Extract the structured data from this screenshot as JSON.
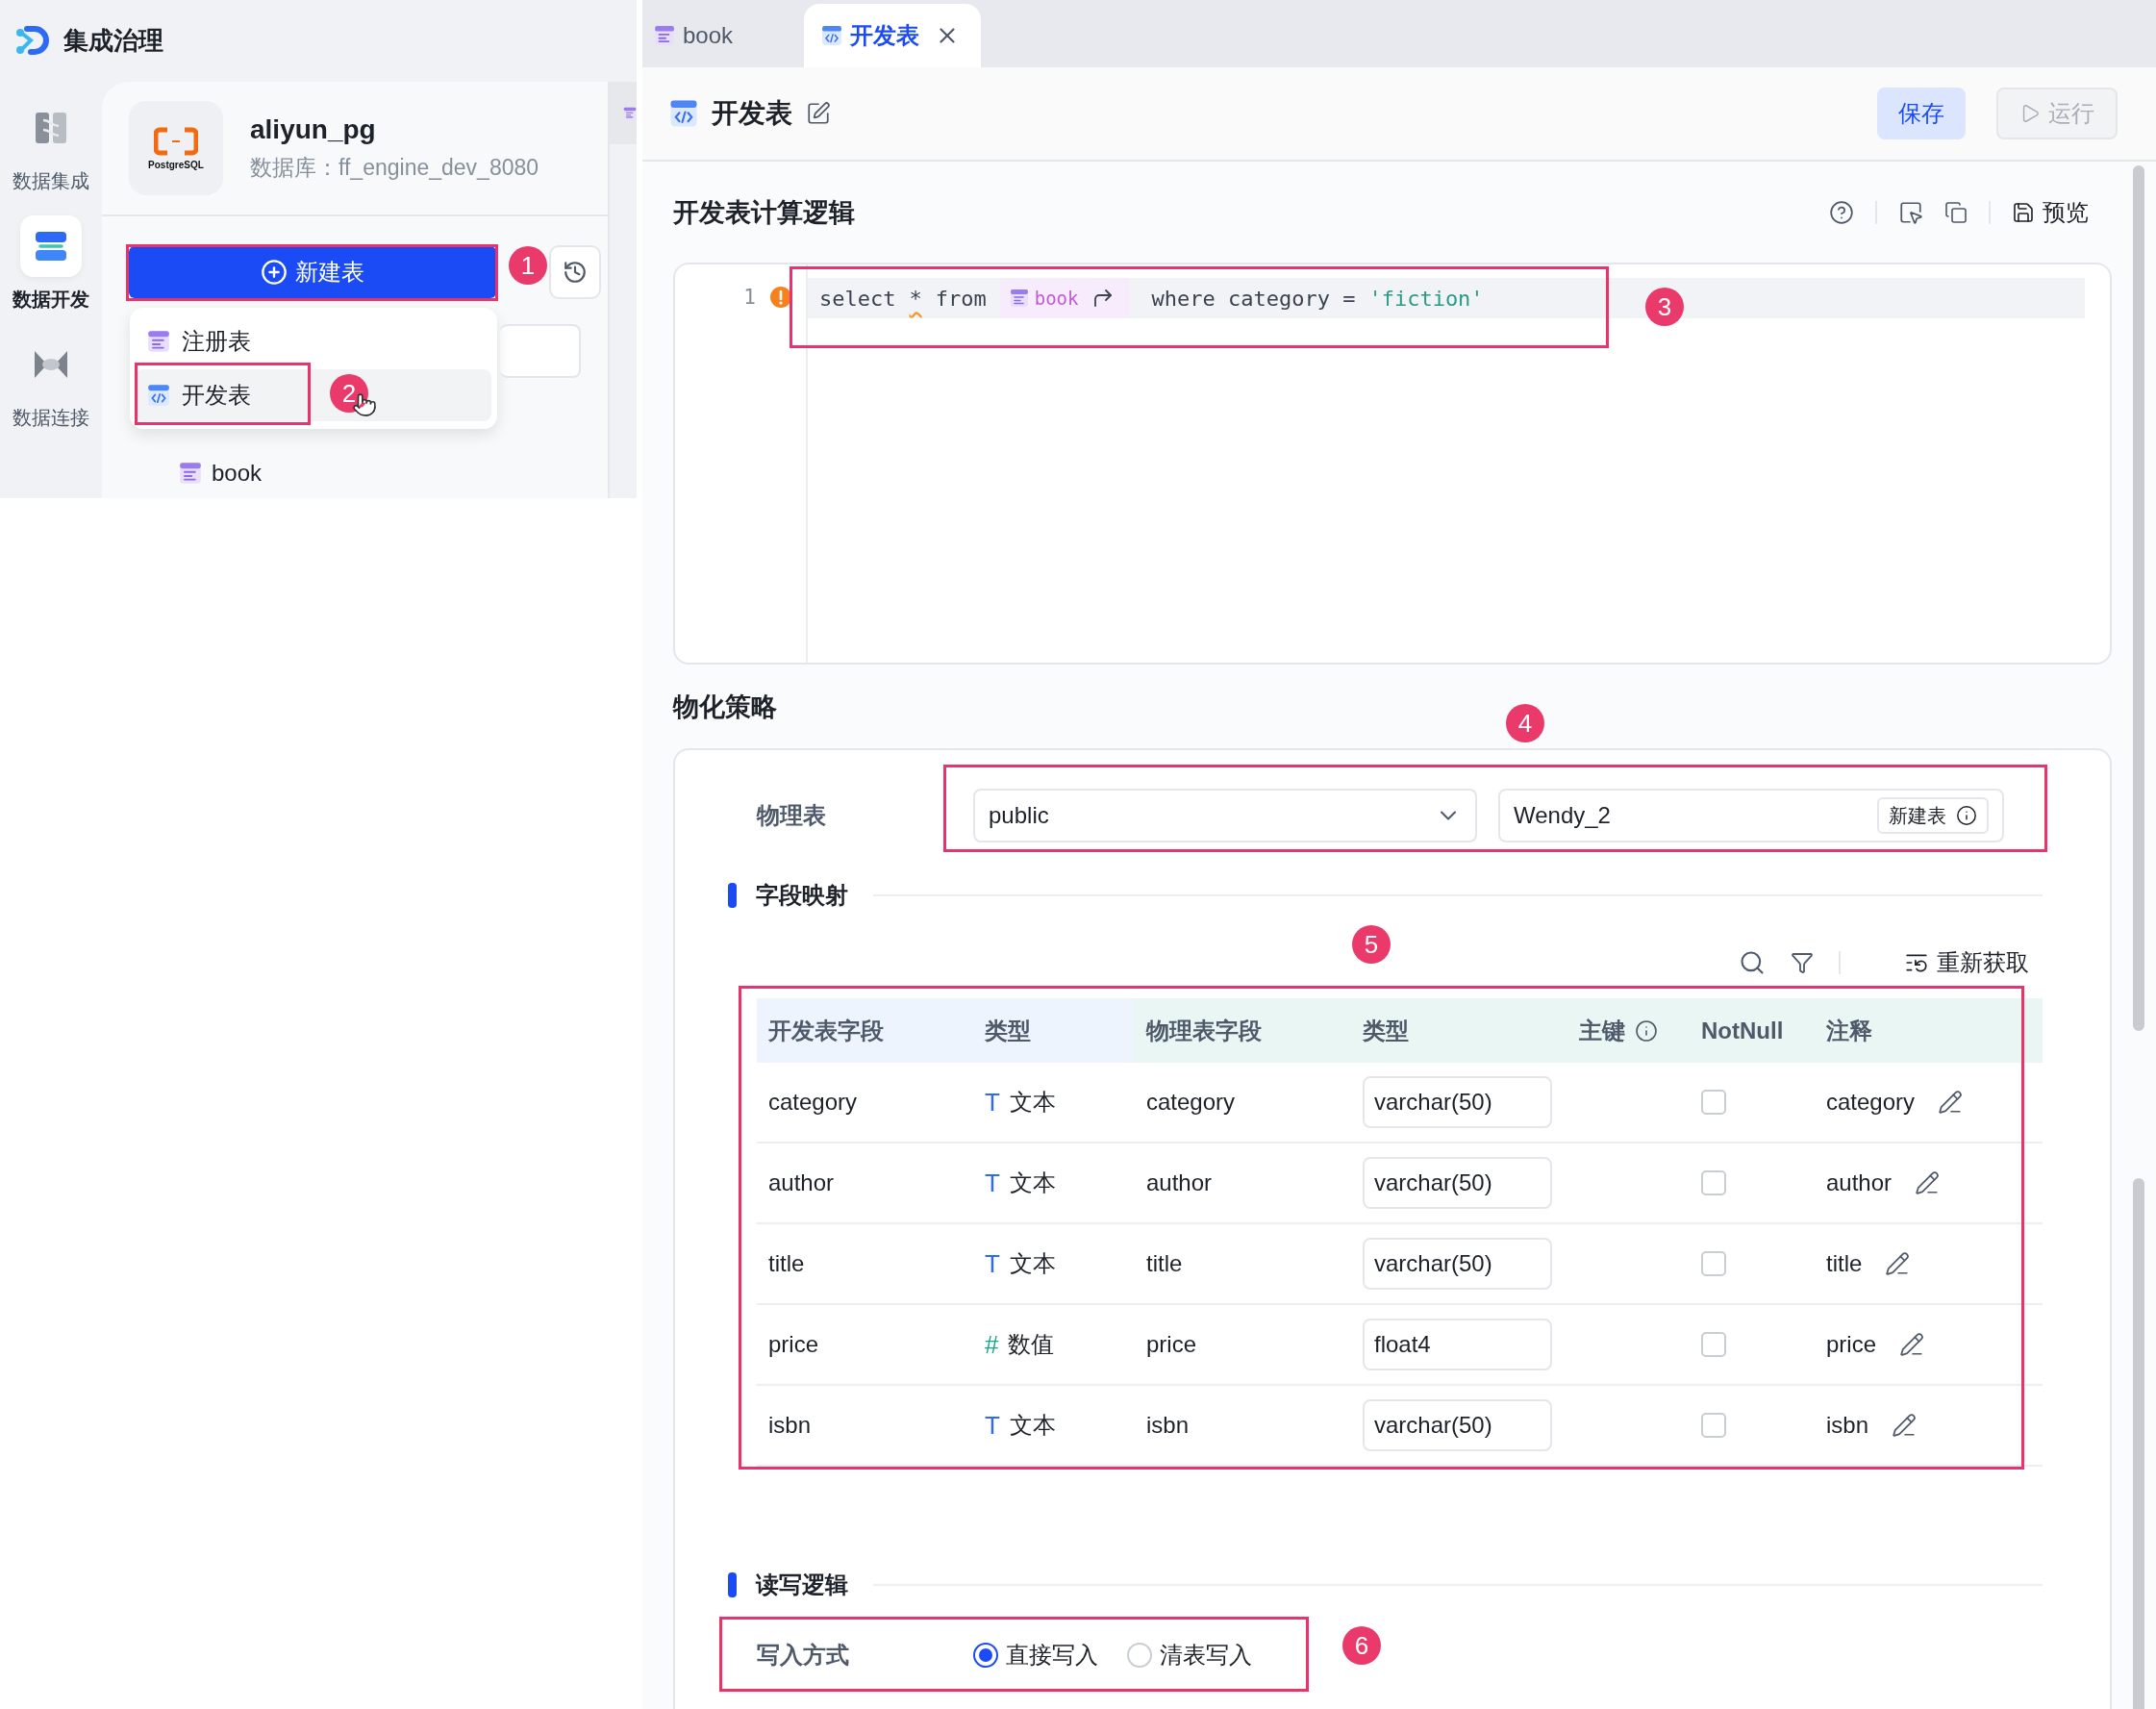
{
  "app": {
    "title": "集成治理"
  },
  "nav": [
    {
      "label": "数据集成",
      "kind": "integration",
      "selected": false
    },
    {
      "label": "数据开发",
      "kind": "develop",
      "selected": true
    },
    {
      "label": "数据连接",
      "kind": "connect",
      "selected": false
    }
  ],
  "source": {
    "logo_text": "PostgreSQL",
    "name": "aliyun_pg",
    "database": "数据库：ff_engine_dev_8080"
  },
  "new_button": "新建表",
  "menu": [
    {
      "label": "注册表",
      "kind": "register",
      "hovered": false
    },
    {
      "label": "开发表",
      "kind": "dev",
      "hovered": true
    }
  ],
  "tree": [
    {
      "label": "book",
      "kind": "register"
    }
  ],
  "tabs": [
    {
      "label": "book",
      "kind": "register",
      "selected": false,
      "closable": false
    },
    {
      "label": "开发表",
      "kind": "dev",
      "selected": true,
      "closable": true
    }
  ],
  "header": {
    "title": "开发表",
    "save": "保存",
    "run": {
      "label": "运行",
      "disabled": true
    }
  },
  "logic": {
    "title": "开发表计算逻辑",
    "preview": "预览",
    "line_number": "1",
    "code": [
      {
        "kind": "keyword",
        "text": "select"
      },
      {
        "kind": "warn",
        "text": "*"
      },
      {
        "kind": "keyword",
        "text": "from"
      },
      {
        "kind": "table",
        "text": "book"
      },
      {
        "kind": "keyword",
        "text": "where category ="
      },
      {
        "kind": "string",
        "text": "'fiction'"
      }
    ]
  },
  "materialize": {
    "title": "物化策略",
    "label": "物理表",
    "schema": "public",
    "table_name": "Wendy_2",
    "new_table": "新建表"
  },
  "mapping": {
    "title": "字段映射",
    "refetch": "重新获取",
    "columns": [
      {
        "label": "开发表字段",
        "kind": "dev"
      },
      {
        "label": "类型",
        "kind": "dev"
      },
      {
        "label": "物理表字段",
        "kind": "physical"
      },
      {
        "label": "类型",
        "kind": "physical"
      },
      {
        "label": "主键",
        "kind": "physical",
        "info": true
      },
      {
        "label": "NotNull",
        "kind": "physical"
      },
      {
        "label": "注释",
        "kind": "physical"
      }
    ],
    "rows": [
      {
        "dev_field": "category",
        "kind": "text",
        "type_icon": "T",
        "type": "文本",
        "phys_field": "category",
        "phys_type": "varchar(50)",
        "not_null": false,
        "comment": "category"
      },
      {
        "dev_field": "author",
        "kind": "text",
        "type_icon": "T",
        "type": "文本",
        "phys_field": "author",
        "phys_type": "varchar(50)",
        "not_null": false,
        "comment": "author"
      },
      {
        "dev_field": "title",
        "kind": "text",
        "type_icon": "T",
        "type": "文本",
        "phys_field": "title",
        "phys_type": "varchar(50)",
        "not_null": false,
        "comment": "title"
      },
      {
        "dev_field": "price",
        "kind": "number",
        "type_icon": "#",
        "type": "数值",
        "phys_field": "price",
        "phys_type": "float4",
        "not_null": false,
        "comment": "price"
      },
      {
        "dev_field": "isbn",
        "kind": "text",
        "type_icon": "T",
        "type": "文本",
        "phys_field": "isbn",
        "phys_type": "varchar(50)",
        "not_null": false,
        "comment": "isbn"
      }
    ]
  },
  "rw": {
    "title": "读写逻辑",
    "label": "写入方式",
    "options": [
      {
        "label": "直接写入",
        "selected": true
      },
      {
        "label": "清表写入",
        "selected": false
      }
    ]
  },
  "annotations": [
    "1",
    "2",
    "3",
    "4",
    "5",
    "6"
  ]
}
